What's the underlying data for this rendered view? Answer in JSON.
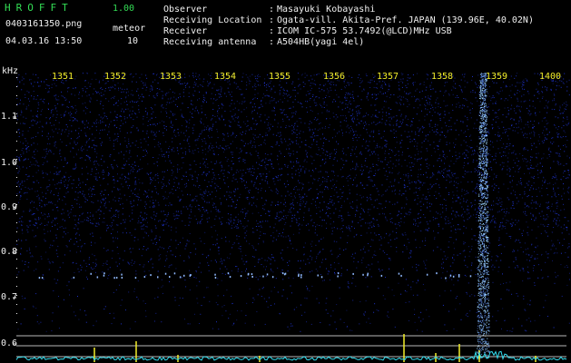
{
  "header": {
    "app_name": "HROFFT",
    "version": "1.00",
    "filename": "0403161350.png",
    "datetime": "04.03.16 13:50",
    "meteor_label": "meteor",
    "meteor_count": "10",
    "fields": [
      {
        "label": "Observer",
        "sep": ":",
        "value": "Masayuki Kobayashi"
      },
      {
        "label": "Receiving Location",
        "sep": ":",
        "value": "Ogata-vill. Akita-Pref. JAPAN (139.96E, 40.02N)"
      },
      {
        "label": "Receiver",
        "sep": ":",
        "value": "ICOM IC-575 53.7492(@LCD)MHz USB"
      },
      {
        "label": "Receiving antenna",
        "sep": ":",
        "value": "A504HB(yagi 4el)"
      }
    ]
  },
  "spectrogram": {
    "y_unit": "kHz",
    "y_ticks": [
      "1.1",
      "1.0",
      "0.9",
      "0.8",
      "0.7",
      "0.6"
    ],
    "x_ticks": [
      "1351",
      "1352",
      "1353",
      "1354",
      "1355",
      "1356",
      "1357",
      "1358",
      "1359",
      "1400"
    ],
    "colors": {
      "background": "#000000",
      "noise": "#1a2c9a",
      "signal": "#9fd6ff",
      "trace": "#33ddee",
      "spike": "#f2ee2a",
      "grid": "#b8b8b8"
    }
  }
}
